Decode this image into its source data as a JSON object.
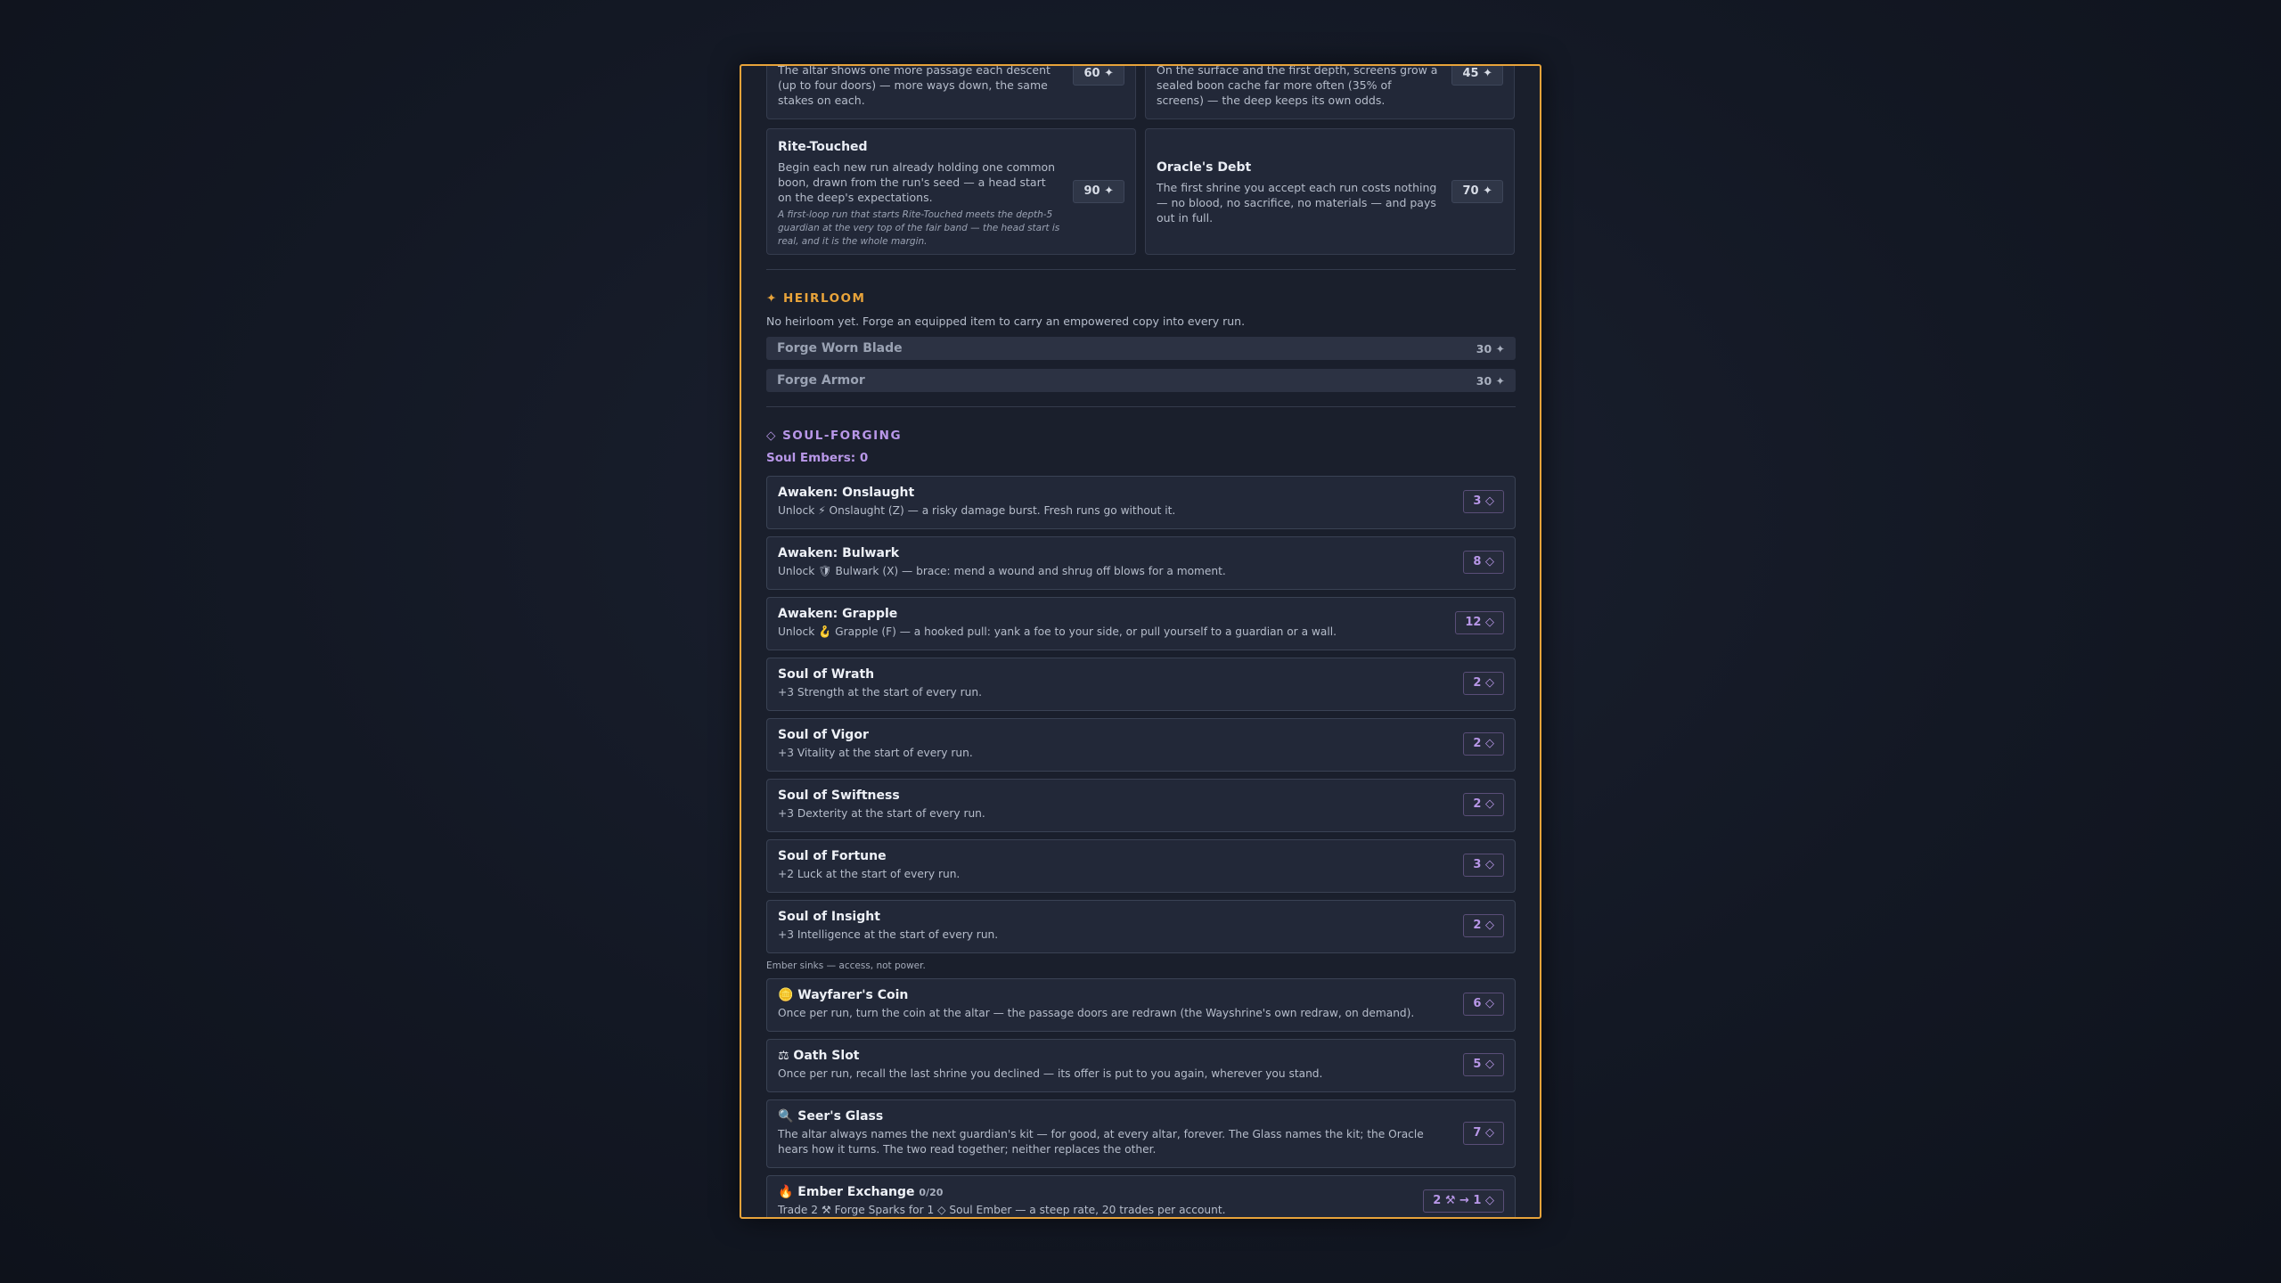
{
  "top_cards": [
    {
      "desc": "The altar shows one more passage each descent (up to four doors) — more ways down, the same stakes on each.",
      "cost": "60 ✦"
    },
    {
      "desc": "On the surface and the first depth, screens grow a sealed boon cache far more often (35% of screens) — the deep keeps its own odds.",
      "cost": "45 ✦"
    }
  ],
  "mid_cards": [
    {
      "title": "Rite-Touched",
      "desc": "Begin each new run already holding one common boon, drawn from the run's seed — a head start on the deep's expectations.",
      "note": "A first-loop run that starts Rite-Touched meets the depth-5 guardian at the very top of the fair band — the head start is real, and it is the whole margin.",
      "cost": "90 ✦"
    },
    {
      "title": "Oracle's Debt",
      "desc": "The first shrine you accept each run costs nothing — no blood, no sacrifice, no materials — and pays out in full.",
      "note": "",
      "cost": "70 ✦"
    }
  ],
  "heirloom": {
    "title": "✦ HEIRLOOM",
    "subtitle": "No heirloom yet. Forge an equipped item to carry an empowered copy into every run.",
    "buttons": [
      {
        "label": "Forge Worn Blade",
        "cost": "30 ✦"
      },
      {
        "label": "Forge Armor",
        "cost": "30 ✦"
      }
    ]
  },
  "soul_forging": {
    "title": "◇ SOUL-FORGING",
    "embers": "Soul Embers: 0",
    "items": [
      {
        "title": "Awaken: Onslaught",
        "desc": "Unlock ⚡ Onslaught (Z) — a risky damage burst. Fresh runs go without it.",
        "cost": "3 ◇"
      },
      {
        "title": "Awaken: Bulwark",
        "desc": "Unlock 🛡 Bulwark (X) — brace: mend a wound and shrug off blows for a moment.",
        "cost": "8 ◇"
      },
      {
        "title": "Awaken: Grapple",
        "desc": "Unlock 🪝 Grapple (F) — a hooked pull: yank a foe to your side, or pull yourself to a guardian or a wall.",
        "cost": "12 ◇"
      },
      {
        "title": "Soul of Wrath",
        "desc": "+3 Strength at the start of every run.",
        "cost": "2 ◇"
      },
      {
        "title": "Soul of Vigor",
        "desc": "+3 Vitality at the start of every run.",
        "cost": "2 ◇"
      },
      {
        "title": "Soul of Swiftness",
        "desc": "+3 Dexterity at the start of every run.",
        "cost": "2 ◇"
      },
      {
        "title": "Soul of Fortune",
        "desc": "+2 Luck at the start of every run.",
        "cost": "3 ◇"
      },
      {
        "title": "Soul of Insight",
        "desc": "+3 Intelligence at the start of every run.",
        "cost": "2 ◇"
      }
    ],
    "sinks_note": "Ember sinks — access, not power.",
    "sinks": [
      {
        "title": "🪙 Wayfarer's Coin",
        "desc": "Once per run, turn the coin at the altar — the passage doors are redrawn (the Wayshrine's own redraw, on demand).",
        "cost": "6 ◇"
      },
      {
        "title": "⚖ Oath Slot",
        "desc": "Once per run, recall the last shrine you declined — its offer is put to you again, wherever you stand.",
        "cost": "5 ◇"
      },
      {
        "title": "🔍 Seer's Glass",
        "desc": "The altar always names the next guardian's kit — for good, at every altar, forever. The Glass names the kit; the Oracle hears how it turns. The two read together; neither replaces the other.",
        "cost": "7 ◇"
      },
      {
        "title": "🔥 Ember Exchange",
        "counter": "0/20",
        "desc": "Trade 2 ⚒ Forge Sparks for 1 ◇ Soul Ember — a steep rate, 20 trades per account.",
        "cost": "2 ⚒ → 1 ◇"
      }
    ]
  }
}
